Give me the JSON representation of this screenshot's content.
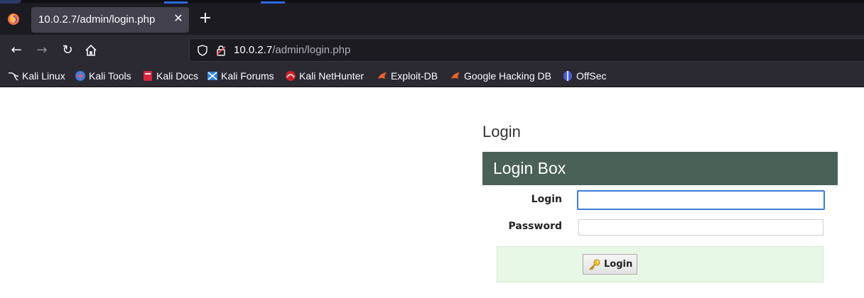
{
  "browser": {
    "tab": {
      "title": "10.0.2.7/admin/login.php",
      "close_glyph": "✕"
    },
    "new_tab_glyph": "+",
    "nav": {
      "back_glyph": "←",
      "forward_glyph": "→",
      "reload_glyph": "↻"
    },
    "url": {
      "host": "10.0.2.7",
      "path": "/admin/login.php"
    },
    "bookmarks": [
      {
        "label": "Kali Linux",
        "icon": "kali-dragon-icon"
      },
      {
        "label": "Kali Tools",
        "icon": "kali-tools-icon"
      },
      {
        "label": "Kali Docs",
        "icon": "kali-docs-icon"
      },
      {
        "label": "Kali Forums",
        "icon": "kali-forums-icon"
      },
      {
        "label": "Kali NetHunter",
        "icon": "nethunter-icon"
      },
      {
        "label": "Exploit-DB",
        "icon": "exploit-db-icon"
      },
      {
        "label": "Google Hacking DB",
        "icon": "ghdb-icon"
      },
      {
        "label": "OffSec",
        "icon": "offsec-icon"
      }
    ]
  },
  "page": {
    "heading": "Login",
    "box_title": "Login Box",
    "login_label": "Login",
    "login_value": "",
    "password_label": "Password",
    "password_value": "",
    "submit_label": "Login",
    "submit_icon": "key-icon"
  },
  "colors": {
    "header_bg": "#4a6157",
    "submit_row_bg": "#e8f8e6",
    "focus_border": "#3a7bd5"
  }
}
